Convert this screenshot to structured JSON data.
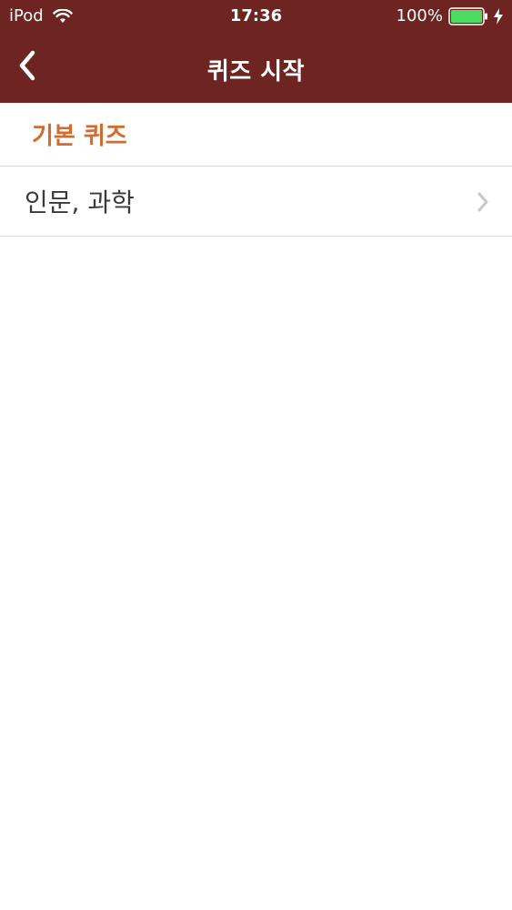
{
  "status_bar": {
    "carrier": "iPod",
    "time": "17:36",
    "battery_percent": "100%",
    "battery_level": 1.0,
    "wifi_icon": "wifi-icon",
    "battery_icon": "battery-icon",
    "charging_icon": "charging-bolt-icon"
  },
  "nav": {
    "title": "퀴즈 시작",
    "back_icon": "chevron-left-icon"
  },
  "section": {
    "header": "기본 퀴즈",
    "items": [
      {
        "label": "인문, 과학",
        "icon": "chevron-right-icon"
      }
    ]
  },
  "colors": {
    "nav_background": "#6e2421",
    "section_header_text": "#d46a2e",
    "battery_fill": "#4cd964",
    "separator": "#d9d9d9",
    "chevron": "#c7c7cc"
  }
}
